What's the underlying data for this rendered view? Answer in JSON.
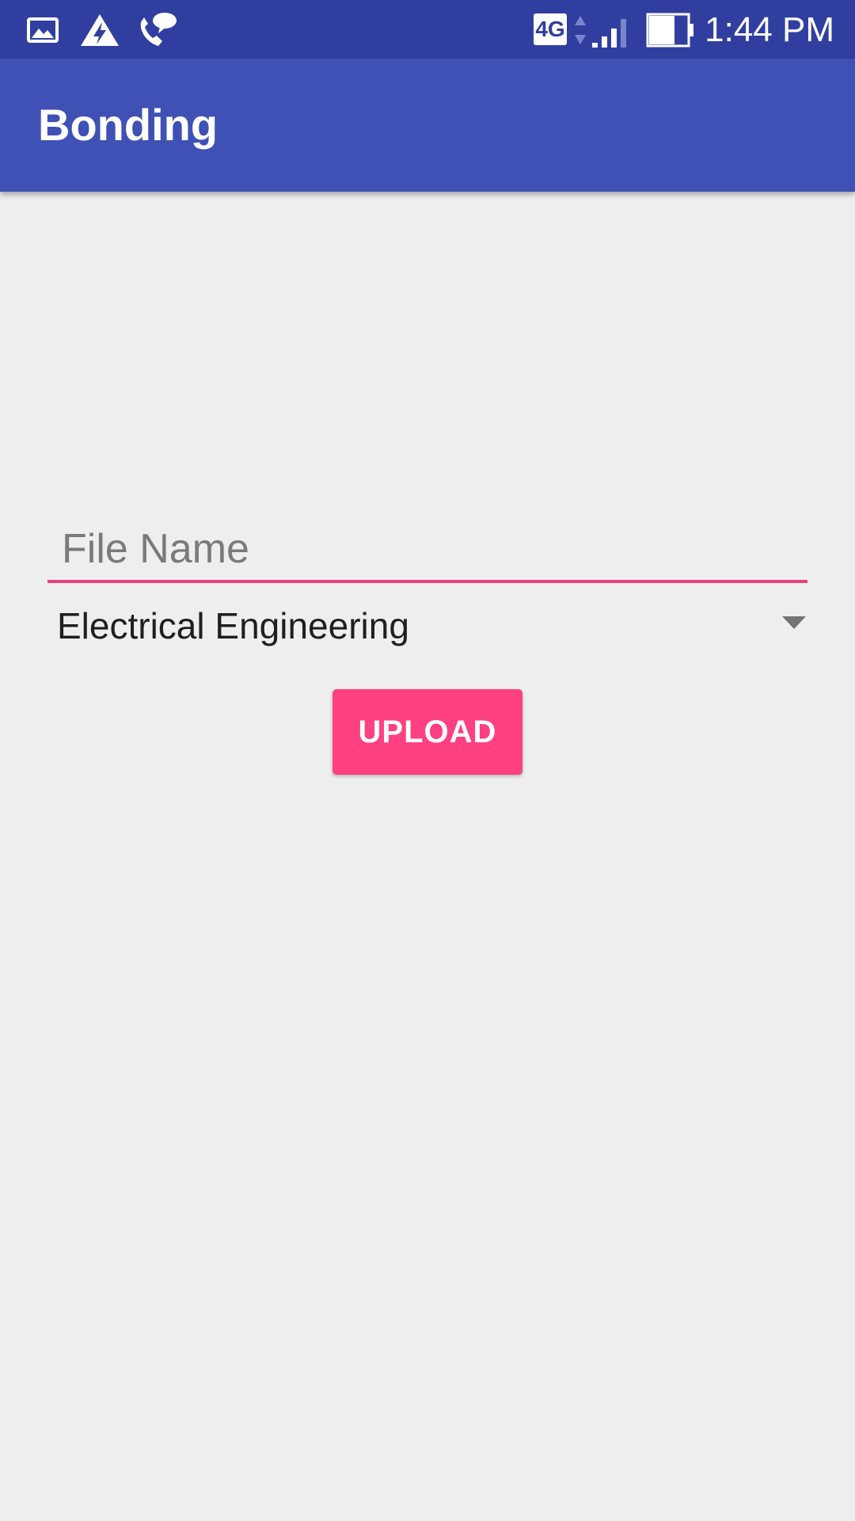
{
  "status_bar": {
    "time": "1:44 PM",
    "network": "4G",
    "icons": [
      "gallery-icon",
      "warning-bolt-icon",
      "phone-chat-icon",
      "network-4g-icon",
      "data-activity-icon",
      "signal-icon",
      "battery-icon"
    ]
  },
  "app_bar": {
    "title": "Bonding",
    "color": "#3f51b5",
    "status_color": "#303f9f"
  },
  "form": {
    "file_name": {
      "value": "",
      "placeholder": "File Name"
    },
    "department": {
      "selected": "Electrical Engineering"
    },
    "upload_label": "UPLOAD"
  },
  "colors": {
    "accent": "#ff4081",
    "underline": "#e9407a",
    "background": "#eeeeef"
  }
}
